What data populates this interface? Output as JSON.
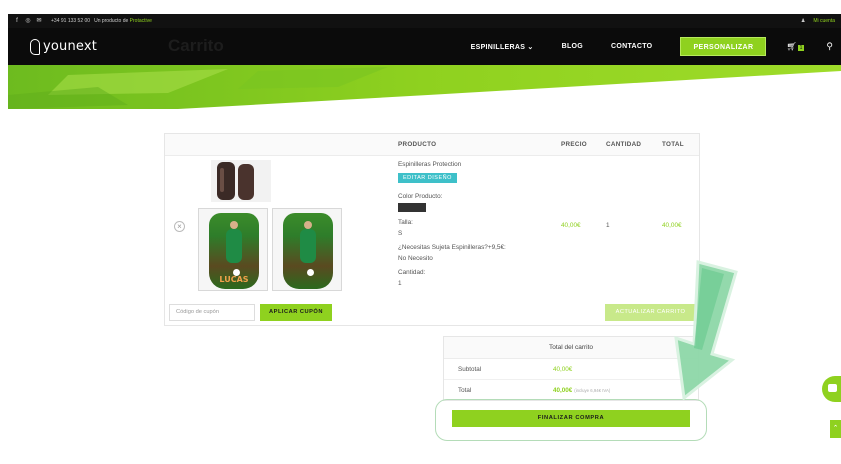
{
  "topbar": {
    "social_icons": [
      "facebook-icon",
      "instagram-icon",
      "mail-icon"
    ],
    "phone": "+34 91 133 52 00",
    "product_of_prefix": "Un producto de",
    "product_of_brand": "Protactive",
    "account_label": "Mi cuenta"
  },
  "nav": {
    "logo_text": "younext",
    "ghost_title": "Carrito",
    "menu": [
      "ESPINILLERAS ⌄",
      "BLOG",
      "CONTACTO"
    ],
    "personalize": "PERSONALIZAR",
    "cart_count": "1"
  },
  "cart": {
    "headers": {
      "product": "PRODUCTO",
      "price": "PRECIO",
      "qty": "CANTIDAD",
      "total": "TOTAL"
    },
    "item": {
      "name": "Espinilleras Protection",
      "edit_label": "EDITAR DISEÑO",
      "color_label": "Color Producto:",
      "size_label": "Talla:",
      "size_value": "S",
      "strap_label": "¿Necesitas Sujeta Espinilleras?+9,5€:",
      "strap_value": "No Necesito",
      "qty_label": "Cantidad:",
      "qty_value": "1",
      "price": "40,00€",
      "qty": "1",
      "total": "40,00€",
      "guard_name": "LUCAS"
    },
    "coupon_placeholder": "Código de cupón",
    "apply_coupon": "APLICAR CUPÓN",
    "update_cart": "ACTUALIZAR CARRITO"
  },
  "totals": {
    "title": "Total del carrito",
    "subtotal_label": "Subtotal",
    "subtotal_value": "40,00€",
    "total_label": "Total",
    "total_value": "40,00€",
    "total_tax": "(incluye 6,94€ IVA)",
    "checkout": "FINALIZAR COMPRA"
  },
  "colors": {
    "accent": "#8fd11f",
    "teal": "#3ec0c9",
    "dark": "#0b0b0b"
  }
}
